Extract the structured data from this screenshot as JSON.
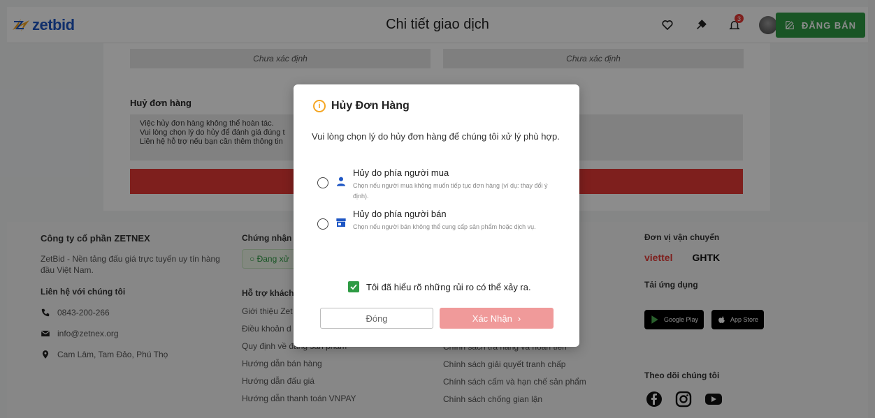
{
  "header": {
    "logo_text": "zetbid",
    "page_title": "Chi tiết giao dịch",
    "notification_count": "3",
    "post_button_label": "ĐĂNG BÁN"
  },
  "content": {
    "status_left": "Chưa xác định",
    "status_right": "Chưa xác định",
    "cancel_heading": "Huỷ đơn hàng",
    "cancel_notes": [
      "Việc hủy đơn hàng không thể hoàn tác.",
      "Vui lòng chọn lý do hủy để đánh giá đúng t",
      "Liên hệ hỗ trợ nếu bạn cần thêm thông tin"
    ]
  },
  "footer": {
    "company": "Công ty cổ phần ZETNEX",
    "tagline": "ZetBid - Nền tảng đấu giá trực tuyến uy tín hàng đầu Việt Nam.",
    "contact_heading": "Liên hệ với chúng tôi",
    "phone": "0843-200-266",
    "email": "info@zetnex.org",
    "address": "Cam Lâm, Tam Đảo, Phú Thọ",
    "cert_heading": "Chứng nhận",
    "cert_status": "Đang xử",
    "support_heading": "Hỗ trợ khách",
    "support_links": [
      "Giới thiệu Zet",
      "Điều khoản d",
      "Quy định về đăng sản phẩm",
      "Hướng dẫn bán hàng",
      "Hướng dẫn đấu giá",
      "Hướng dẫn thanh toán VNPAY"
    ],
    "policy_links": [
      "Chính sách trả hàng và hoàn tiền",
      "Chính sách giải quyết tranh chấp",
      "Chính sách cấm và hạn chế sản phẩm",
      "Chính sách chống gian lận"
    ],
    "shipping_heading": "Đơn vị vận chuyển",
    "carrier_1": "viettel",
    "carrier_2": "GHTK",
    "app_heading": "Tải ứng dụng",
    "google_play": "Google Play",
    "app_store": "App Store",
    "follow_heading": "Theo dõi chúng tôi"
  },
  "modal": {
    "title": "Hủy Đơn Hàng",
    "description": "Vui lòng chọn lý do hủy đơn hàng để chúng tôi xử lý phù hợp.",
    "options": [
      {
        "title": "Hủy do phía người mua",
        "subtitle": "Chọn nếu người mua không muốn tiếp tục đơn hàng (ví dụ: thay đổi ý định).",
        "icon": "user-icon"
      },
      {
        "title": "Hủy do phía người bán",
        "subtitle": "Chọn nếu người bán không thể cung cấp sản phẩm hoặc dịch vụ.",
        "icon": "store-icon"
      }
    ],
    "acknowledge_label": "Tôi đã hiểu rõ những rủi ro có thể xảy ra.",
    "close_label": "Đóng",
    "confirm_label": "Xác Nhận",
    "accent_color": "#f5a623",
    "check_color": "#2e9b44",
    "confirm_color": "#f09a9a"
  }
}
